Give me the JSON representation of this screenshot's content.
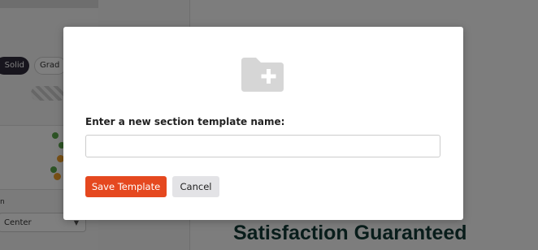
{
  "background": {
    "sidebar": {
      "solid_label": "Solid",
      "gradient_label": "Grad",
      "field_label": "n",
      "select_value": "Center"
    },
    "canvas": {
      "headline": "Satisfaction Guaranteed"
    }
  },
  "modal": {
    "icon": "folder-plus-icon",
    "label": "Enter a new section template name:",
    "input_value": "",
    "input_placeholder": "",
    "save_label": "Save Template",
    "cancel_label": "Cancel"
  },
  "colors": {
    "save_button": "#e5481f",
    "cancel_button": "#e3e3e6",
    "headline": "#123a37"
  }
}
